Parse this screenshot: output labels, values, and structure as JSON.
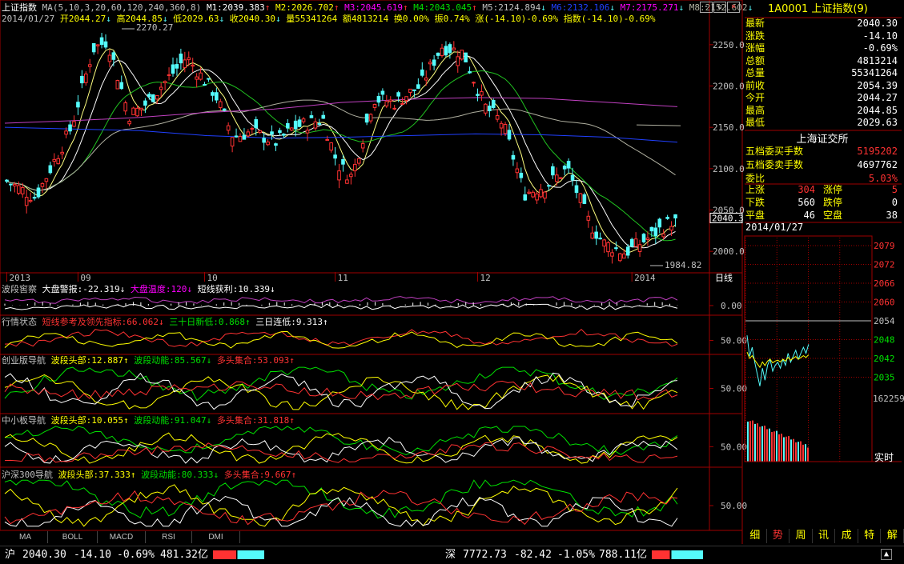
{
  "colors": {
    "bg": "#000000",
    "grid": "#a00000",
    "up": "#ff3232",
    "down": "#54fcfc",
    "yellow": "#ffff00",
    "magenta": "#ff00ff",
    "green": "#00e000",
    "white": "#ffffff",
    "ma_yellow": "#ffff80",
    "ma_green": "#20c020",
    "ma_blue": "#2040ff",
    "ma_purple": "#c040c0",
    "ma_grey": "#b0b0a0"
  },
  "header": {
    "index_name": "上证指数",
    "ma_label": "MA(5,10,3,20,60,120,240,360,8)",
    "m1": "M1:2039.383",
    "m2": "M2:2026.702",
    "m3": "M3:2045.619",
    "m4": "M4:2043.045",
    "m5": "M5:2124.894",
    "m6": "M6:2132.106",
    "m7": "M7:2175.271",
    "m8": "M8:2152.602",
    "date": "2014/01/27",
    "open": "开2044.27",
    "high": "高2044.85",
    "low": "低2029.63",
    "close": "收2040.30",
    "vol": "量55341264",
    "amount": "额4813214",
    "turnover": "换0.00%",
    "amplitude": "振0.74%",
    "change": "涨(-14.10)-0.69%",
    "index_chg": "指数(-14.10)-0.69%",
    "high_mark": "2270.27",
    "low_mark": "1984.82",
    "current_price_tag": "2040.3"
  },
  "price_axis": [
    {
      "v": 2250,
      "label": "2250.0"
    },
    {
      "v": 2200,
      "label": "2200.0"
    },
    {
      "v": 2150,
      "label": "2150.0"
    },
    {
      "v": 2100,
      "label": "2100.0"
    },
    {
      "v": 2050,
      "label": "2050.0"
    },
    {
      "v": 2000,
      "label": "2000.0"
    }
  ],
  "date_axis": [
    {
      "i": 0,
      "label": "2013"
    },
    {
      "i": 18,
      "label": "09"
    },
    {
      "i": 50,
      "label": "10"
    },
    {
      "i": 83,
      "label": "11"
    },
    {
      "i": 119,
      "label": "12"
    },
    {
      "i": 158,
      "label": "2014"
    }
  ],
  "period_label": "日线",
  "panels": [
    {
      "id": "p1",
      "title": "波段窖察",
      "items": [
        {
          "text": "大盘警报:-22.319↓",
          "color": "#ffffff"
        },
        {
          "text": "大盘温度:120↓",
          "color": "#ff00ff"
        },
        {
          "text": "短线获利:10.339↓",
          "color": "#ffffff"
        }
      ],
      "axis": [
        "0.00"
      ]
    },
    {
      "id": "p2",
      "title": "行情状态",
      "items": [
        {
          "text": "短线参考及领先指标:66.062↓",
          "color": "#ff3232"
        },
        {
          "text": "三十日新低:0.868↑",
          "color": "#00e000"
        },
        {
          "text": "三日连低:9.313↑",
          "color": "#ffffff"
        }
      ],
      "axis": [
        "50.00"
      ]
    },
    {
      "id": "p3",
      "title": "创业版导航",
      "items": [
        {
          "text": "波段头部:12.887↑",
          "color": "#ffff00"
        },
        {
          "text": "波段动能:85.567↓",
          "color": "#00e000"
        },
        {
          "text": "多头集合:53.093↑",
          "color": "#ff3232"
        }
      ],
      "axis": [
        "50.00"
      ]
    },
    {
      "id": "p4",
      "title": "中小板导航",
      "items": [
        {
          "text": "波段头部:10.055↑",
          "color": "#ffff00"
        },
        {
          "text": "波段动能:91.047↓",
          "color": "#00e000"
        },
        {
          "text": "多头集合:31.818↑",
          "color": "#ff3232"
        }
      ],
      "axis": [
        "50.00"
      ]
    },
    {
      "id": "p5",
      "title": "沪深300导航",
      "items": [
        {
          "text": "波段头部:37.333↑",
          "color": "#ffff00"
        },
        {
          "text": "波段动能:80.333↓",
          "color": "#00e000"
        },
        {
          "text": "多头集合:9.667↑",
          "color": "#ff3232"
        }
      ],
      "axis": [
        "50.00"
      ]
    }
  ],
  "bottom_tabs": [
    "MA",
    "BOLL",
    "MACD",
    "RSI",
    "DMI"
  ],
  "quote": {
    "code": "1A0001",
    "name": "上证指数",
    "count": "(9)",
    "rows": [
      {
        "label": "最新",
        "value": "2040.30",
        "color": "#ffffff"
      },
      {
        "label": "涨跌",
        "value": "-14.10",
        "color": "#ffffff"
      },
      {
        "label": "涨幅",
        "value": "-0.69%",
        "color": "#ffffff"
      },
      {
        "label": "总额",
        "value": "4813214",
        "color": "#ffffff"
      },
      {
        "label": "总量",
        "value": "55341264",
        "color": "#ffffff"
      },
      {
        "label": "前收",
        "value": "2054.39",
        "color": "#ffffff"
      },
      {
        "label": "今开",
        "value": "2044.27",
        "color": "#ffffff"
      },
      {
        "label": "最高",
        "value": "2044.85",
        "color": "#ffffff"
      },
      {
        "label": "最低",
        "value": "2029.63",
        "color": "#ffffff"
      }
    ],
    "exchange": "上海证交所",
    "rows2": [
      {
        "label": "五档委买手数",
        "value": "5195202",
        "color": "#ff3232"
      },
      {
        "label": "五档委卖手数",
        "value": "4697762",
        "color": "#ffffff"
      },
      {
        "label": "委比",
        "value": "5.03%",
        "color": "#ff3232"
      }
    ],
    "breadth": [
      {
        "l1": "上涨",
        "v1": "304",
        "c1": "#ff3232",
        "l2": "涨停",
        "v2": "5",
        "c2": "#ff3232"
      },
      {
        "l1": "下跌",
        "v1": "560",
        "c1": "#ffffff",
        "l2": "跌停",
        "v2": "0",
        "c2": "#ffffff"
      },
      {
        "l1": "平盘",
        "v1": "46",
        "c1": "#ffffff",
        "l2": "空盘",
        "v2": "38",
        "c2": "#ffffff"
      }
    ],
    "mini_date": "2014/01/27",
    "mini_axis": [
      "2079",
      "2072",
      "2066",
      "2060",
      "2054",
      "2048",
      "2042",
      "2035"
    ],
    "mini_vol_label": "162259",
    "realtime_label": "实时"
  },
  "side_tabs": [
    "细",
    "势",
    "周",
    "讯",
    "成",
    "特",
    "解"
  ],
  "status": {
    "sh_label": "沪",
    "sh_price": "2040.30",
    "sh_chg": "-14.10",
    "sh_pct": "-0.69%",
    "sh_amt": "481.32亿",
    "sz_label": "深",
    "sz_price": "7772.73",
    "sz_chg": "-82.42",
    "sz_pct": "-1.05%",
    "sz_amt": "788.11亿"
  },
  "window_controls": {
    "minimize": "-",
    "restore": "▫",
    "close": "×"
  }
}
